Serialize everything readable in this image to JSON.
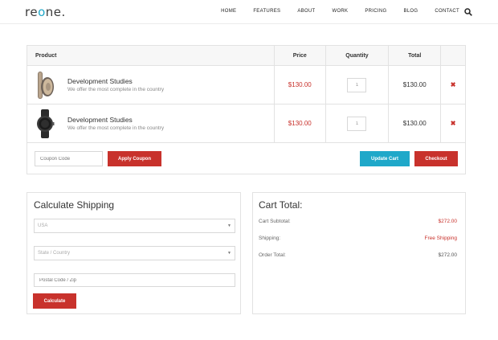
{
  "brand": {
    "logo_pre": "re",
    "logo_o": "o",
    "logo_post": "ne."
  },
  "nav": [
    "HOME",
    "FEATURES",
    "ABOUT",
    "WORK",
    "PRICING",
    "BLOG",
    "CONTACT"
  ],
  "colors": {
    "accent_red": "#c8322c",
    "accent_blue": "#1fa8c9"
  },
  "cart": {
    "headers": {
      "product": "Product",
      "price": "Price",
      "quantity": "Quantity",
      "total": "Total"
    },
    "items": [
      {
        "name": "Development Studies",
        "desc": "We offer the most complete in the country",
        "price": "$130.00",
        "qty": "1",
        "total": "$130.00",
        "thumb_icon": "headphones-icon"
      },
      {
        "name": "Development Studies",
        "desc": "We offer the most complete in the country",
        "price": "$130.00",
        "qty": "1",
        "total": "$130.00",
        "thumb_icon": "watch-icon"
      }
    ],
    "remove_symbol": "✖",
    "coupon_placeholder": "Coupon Code",
    "apply_label": "Apply Coupon",
    "update_label": "Update Cart",
    "checkout_label": "Checkout"
  },
  "shipping": {
    "title": "Calculate Shipping",
    "country_value": "USA",
    "state_value": "State / Country",
    "postal_placeholder": "Postal Code / Zip",
    "calculate_label": "Calculate"
  },
  "totals": {
    "title": "Cart Total:",
    "subtotal_label": "Cart Subtotal:",
    "subtotal_value": "$272.00",
    "shipping_label": "Shipping:",
    "shipping_value": "Free Shipping",
    "order_label": "Order Total:",
    "order_value": "$272.00"
  }
}
